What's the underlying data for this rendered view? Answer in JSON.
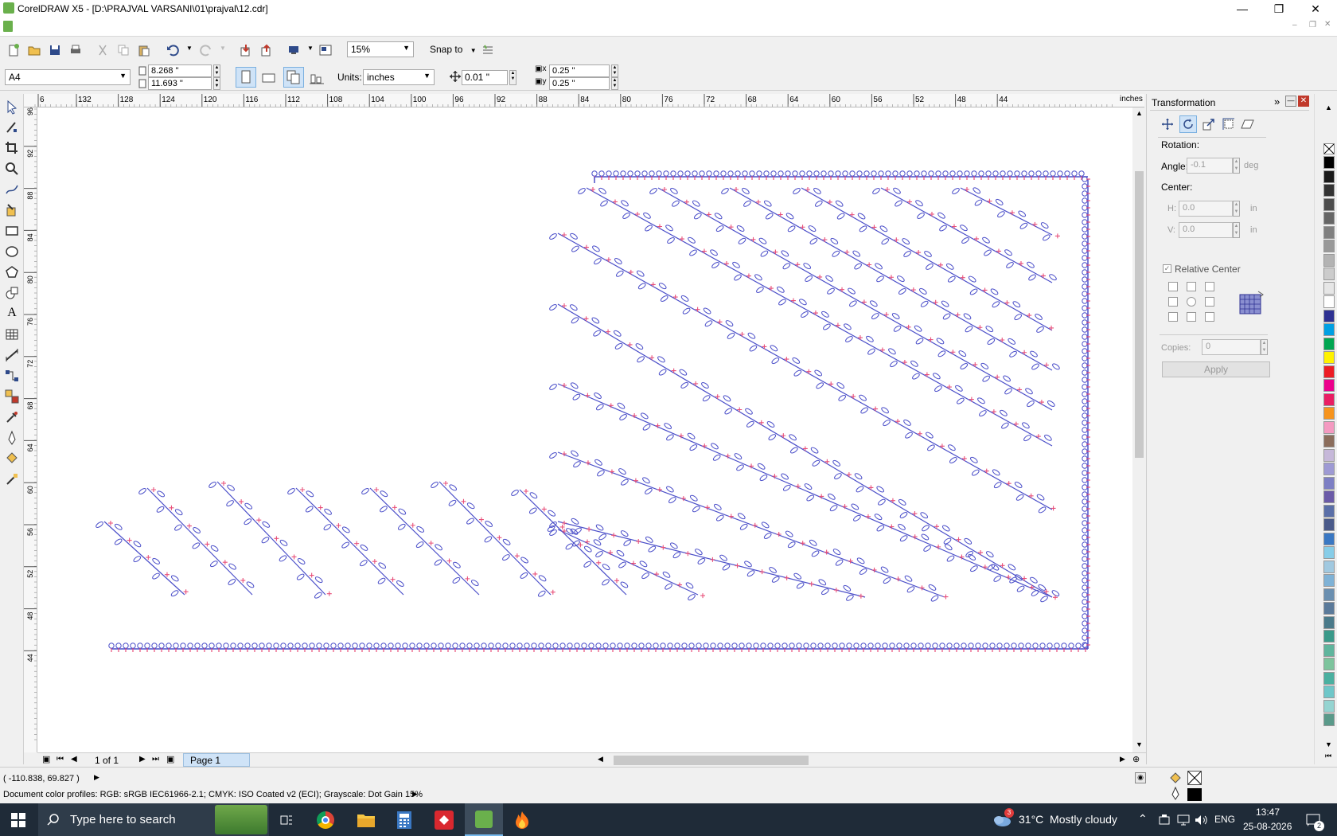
{
  "window": {
    "title": "CorelDRAW X5 - [D:\\PRAJVAL VARSANI\\01\\prajval\\12.cdr]",
    "minimize_icon": "minimize-icon",
    "restore_icon": "restore-icon",
    "close_icon": "close-icon"
  },
  "toolbar": {
    "zoom": "15%",
    "snap_to": "Snap to",
    "page_size": "A4",
    "width": "8.268 \"",
    "height": "11.693 \"",
    "units_label": "Units:",
    "units_value": "inches",
    "nudge": "0.01 \"",
    "dup_x": "0.25 \"",
    "dup_y": "0.25 \""
  },
  "rulers": {
    "unit": "inches",
    "h_ticks": [
      "6",
      "132",
      "128",
      "124",
      "120",
      "116",
      "112",
      "108",
      "104",
      "100",
      "96",
      "92",
      "88",
      "84",
      "80",
      "76",
      "72",
      "68",
      "64",
      "60",
      "56",
      "52",
      "48",
      "44"
    ],
    "v_ticks": [
      "96",
      "92",
      "88",
      "84",
      "80",
      "76",
      "72",
      "68",
      "64",
      "60",
      "56",
      "52",
      "48",
      "44"
    ]
  },
  "pagebar": {
    "page_count": "1 of 1",
    "page_tab": "Page 1"
  },
  "docker": {
    "title": "Transformation",
    "rotation_label": "Rotation:",
    "angle_label": "Angle:",
    "angle_value": "-0.1",
    "angle_unit": "deg",
    "center_label": "Center:",
    "h_label": "H:",
    "h_value": "0.0",
    "v_label": "V:",
    "v_value": "0.0",
    "center_unit": "in",
    "relative_center": "Relative Center",
    "copies_label": "Copies:",
    "copies_value": "0",
    "apply": "Apply"
  },
  "status": {
    "coords": "( -110.838, 69.827 )",
    "color_profiles": "Document color profiles: RGB: sRGB IEC61966-2.1; CMYK: ISO Coated v2 (ECI); Grayscale: Dot Gain 15%"
  },
  "taskbar": {
    "search_placeholder": "Type here to search",
    "weather": "31°C  Mostly cloudy",
    "weather_badge": "3",
    "language": "ENG",
    "time": "13:47",
    "date": "25-08-2026",
    "notification_count": "2"
  },
  "palette_colors": [
    "#000000",
    "#1a1a1a",
    "#333333",
    "#4d4d4d",
    "#666666",
    "#808080",
    "#999999",
    "#b3b3b3",
    "#cccccc",
    "#e6e6e6",
    "#ffffff",
    "#2e3192",
    "#00a0e3",
    "#00a651",
    "#fff200",
    "#ed1c24",
    "#ec008c",
    "#e91e63",
    "#f7941d",
    "#f49ac1",
    "#8b6d5c",
    "#c6b8d9",
    "#9e9ad4",
    "#7d7fc4",
    "#6b5ba8",
    "#5a6fa8",
    "#4a5a8a",
    "#3a78c3",
    "#87cde8",
    "#a1c9e0",
    "#7fb2d6",
    "#6a8fb0",
    "#5b7a9a",
    "#4a7a8a",
    "#3a9a8a",
    "#5fb59d",
    "#7dc49d",
    "#4ab0a0",
    "#6fc7c9",
    "#95d4d1",
    "#5a9a8a"
  ],
  "colors": {
    "accent": "#2e3192",
    "motif_blue": "#4b4fc9",
    "motif_red": "#e8507a"
  }
}
